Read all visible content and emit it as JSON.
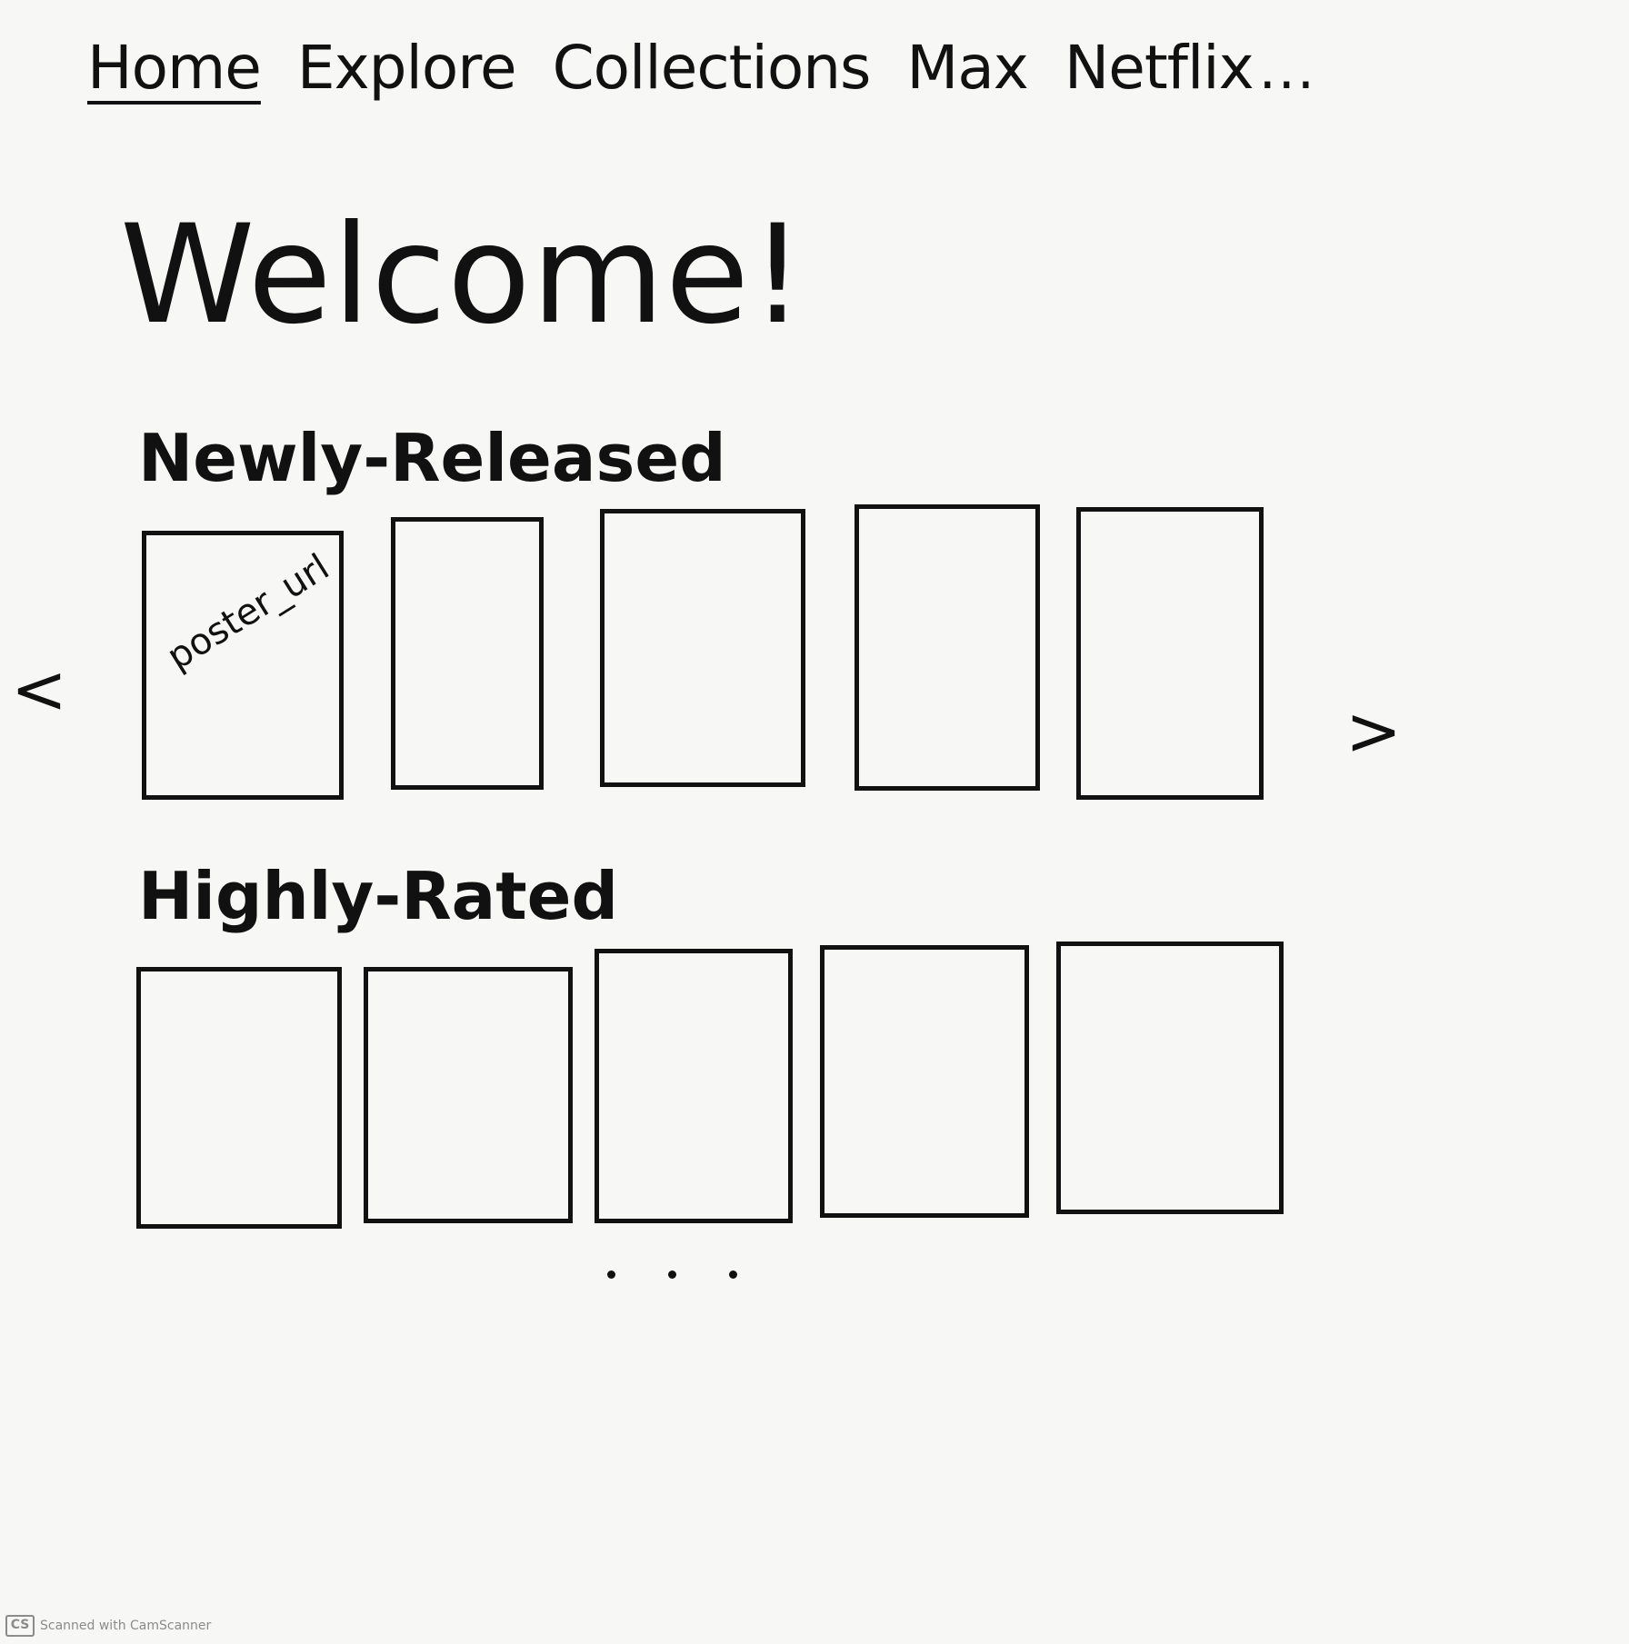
{
  "nav": {
    "items": [
      {
        "label": "Home",
        "active": true
      },
      {
        "label": "Explore",
        "active": false
      },
      {
        "label": "Collections",
        "active": false
      },
      {
        "label": "Max",
        "active": false
      },
      {
        "label": "Netflix",
        "active": false
      }
    ],
    "more": "..."
  },
  "welcome": "Welcome!",
  "sections": [
    {
      "title": "Newly-Released",
      "cards": [
        {
          "label": "poster_url"
        },
        {
          "label": ""
        },
        {
          "label": ""
        },
        {
          "label": ""
        },
        {
          "label": ""
        }
      ],
      "prev_arrow": "<",
      "next_arrow": ">"
    },
    {
      "title": "Highly-Rated",
      "cards": [
        {
          "label": ""
        },
        {
          "label": ""
        },
        {
          "label": ""
        },
        {
          "label": ""
        },
        {
          "label": ""
        }
      ]
    }
  ],
  "watermark": {
    "logo": "CS",
    "text": "Scanned with CamScanner"
  }
}
